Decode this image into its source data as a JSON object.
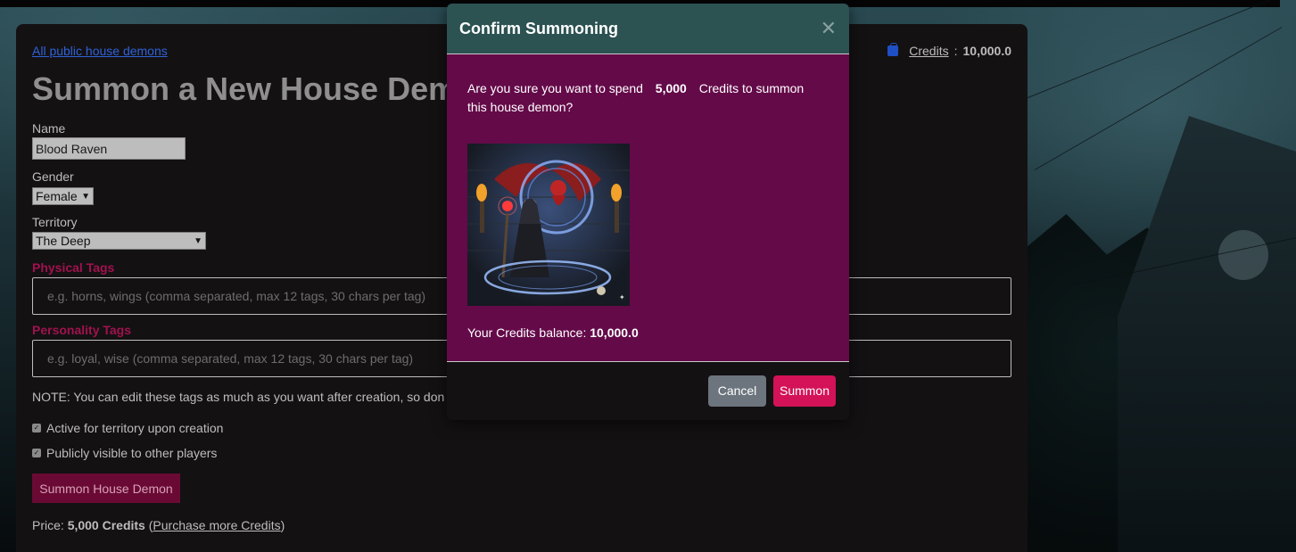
{
  "page": {
    "back_link": "All public house demons",
    "credits_label": "Credits",
    "credits_value": "10,000.0",
    "title": "Summon a New House Demon",
    "name_label": "Name",
    "name_value": "Blood Raven",
    "gender_label": "Gender",
    "gender_value": "Female",
    "territory_label": "Territory",
    "territory_value": "The Deep",
    "physical_tags_label": "Physical Tags",
    "physical_tags_placeholder": "e.g. horns, wings (comma separated, max 12 tags, 30 chars per tag)",
    "personality_tags_label": "Personality Tags",
    "personality_tags_placeholder": "e.g. loyal, wise (comma separated, max 12 tags, 30 chars per tag)",
    "note": "NOTE: You can edit these tags as much as you want after creation, so don",
    "checkbox_active_label": "Active for territory upon creation",
    "checkbox_public_label": "Publicly visible to other players",
    "summon_button_label": "Summon House Demon",
    "price_prefix": "Price:",
    "price_value": "5,000 Credits",
    "purchase_link": "Purchase more Credits"
  },
  "modal": {
    "title": "Confirm Summoning",
    "close_glyph": "✕",
    "question_prefix": "Are you sure you want to spend",
    "question_amount": "5,000",
    "question_suffix": "Credits to summon this house demon?",
    "balance_label": "Your Credits balance:",
    "balance_value": "10,000.0",
    "cancel_label": "Cancel",
    "summon_label": "Summon"
  },
  "icons": {
    "credits": "shopping-bag-icon",
    "close": "close-icon",
    "checkbox": "check-icon",
    "dropdown": "chevron-down-icon"
  },
  "colors": {
    "accent": "#d31257",
    "modal_header": "#2c5252",
    "modal_body": "#640a49",
    "tag_label": "#a0124e",
    "link": "#2f62d8"
  }
}
